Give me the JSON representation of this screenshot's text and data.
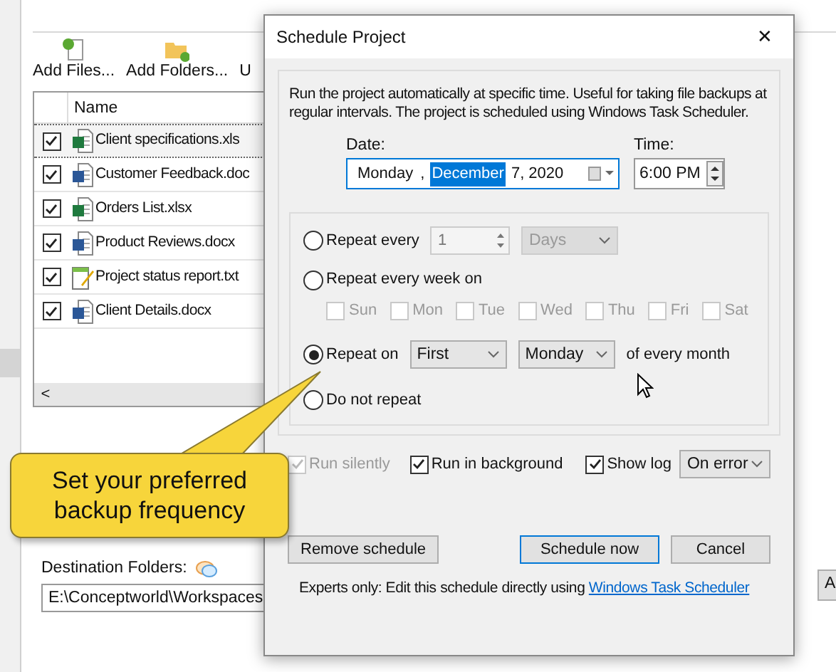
{
  "app": {
    "toolbar": [
      {
        "label": "Add Files...",
        "kind": "files"
      },
      {
        "label": "Add Folders...",
        "kind": "folders"
      },
      {
        "label": "U",
        "kind": "cut"
      }
    ],
    "file_list": {
      "columns": [
        "Name"
      ],
      "rows": [
        {
          "name": "Client specifications.xls",
          "checked": true,
          "selected": true,
          "kind": "excel"
        },
        {
          "name": "Customer Feedback.doc",
          "checked": true,
          "selected": false,
          "kind": "word"
        },
        {
          "name": "Orders List.xlsx",
          "checked": true,
          "selected": false,
          "kind": "excel"
        },
        {
          "name": "Product Reviews.docx",
          "checked": true,
          "selected": false,
          "kind": "word"
        },
        {
          "name": "Project status report.txt",
          "checked": true,
          "selected": false,
          "kind": "text"
        },
        {
          "name": "Client Details.docx",
          "checked": true,
          "selected": false,
          "kind": "word"
        }
      ]
    },
    "scroll_left": "<",
    "destination": {
      "label": "Destination Folders:",
      "value": "E:\\Conceptworld\\Workspaces"
    },
    "side_button": "A"
  },
  "dialog": {
    "title": "Schedule Project",
    "close": "✕",
    "description": "Run the project automatically at specific time. Useful for taking file backups at regular intervals. The project is scheduled using Windows Task Scheduler.",
    "date": {
      "label": "Date:",
      "segments": [
        {
          "text": "Monday",
          "selected": false
        },
        {
          "text": ",",
          "selected": false
        },
        {
          "text": "December",
          "selected": true
        },
        {
          "text": "7, 2020",
          "selected": false
        }
      ]
    },
    "time": {
      "label": "Time:",
      "value": "6:00 PM"
    },
    "options": [
      {
        "kind": "interval",
        "label": "Repeat every",
        "selected": false,
        "value": "1",
        "unit": "Days",
        "disabled": true
      },
      {
        "kind": "weekly",
        "label": "Repeat every week on",
        "selected": false,
        "days": [
          {
            "label": "Sun",
            "checked": false,
            "disabled": true
          },
          {
            "label": "Mon",
            "checked": false,
            "disabled": true
          },
          {
            "label": "Tue",
            "checked": false,
            "disabled": true
          },
          {
            "label": "Wed",
            "checked": false,
            "disabled": true
          },
          {
            "label": "Thu",
            "checked": false,
            "disabled": true
          },
          {
            "label": "Fri",
            "checked": false,
            "disabled": true
          },
          {
            "label": "Sat",
            "checked": false,
            "disabled": true
          }
        ]
      },
      {
        "kind": "monthly",
        "label": "Repeat on",
        "selected": true,
        "which": "First",
        "weekday": "Monday",
        "suffix": "of every month"
      },
      {
        "kind": "none",
        "label": "Do not repeat",
        "selected": false
      }
    ],
    "checkboxes": [
      {
        "label": "Run silently",
        "checked": true,
        "disabled": true
      },
      {
        "label": "Run in background",
        "checked": true,
        "disabled": false
      },
      {
        "label": "Show log",
        "checked": true,
        "disabled": false
      }
    ],
    "log_mode": "On error",
    "buttons": [
      {
        "label": "Remove schedule",
        "default": false
      },
      {
        "label": "Schedule now",
        "default": true
      },
      {
        "label": "Cancel",
        "default": false
      }
    ],
    "footer": {
      "text": "Experts only: Edit this schedule directly using",
      "link": "Windows Task Scheduler"
    }
  },
  "callout": {
    "text": "Set your preferred backup frequency"
  }
}
